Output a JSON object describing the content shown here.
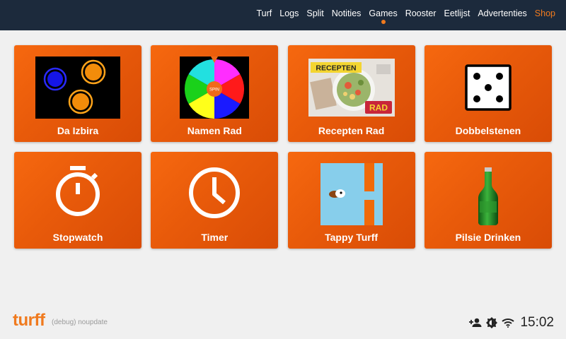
{
  "nav": {
    "items": [
      {
        "label": "Turf"
      },
      {
        "label": "Logs"
      },
      {
        "label": "Split"
      },
      {
        "label": "Notities"
      },
      {
        "label": "Games"
      },
      {
        "label": "Rooster"
      },
      {
        "label": "Eetlijst"
      },
      {
        "label": "Advertenties"
      },
      {
        "label": "Shop"
      }
    ],
    "active": "Games"
  },
  "tiles": [
    {
      "label": "Da Izbira"
    },
    {
      "label": "Namen Rad",
      "spin_text": "SPIN"
    },
    {
      "label": "Recepten Rad",
      "banner_top": "RECEPTEN",
      "banner_bottom": "RAD"
    },
    {
      "label": "Dobbelstenen"
    },
    {
      "label": "Stopwatch"
    },
    {
      "label": "Timer"
    },
    {
      "label": "Tappy Turff"
    },
    {
      "label": "Pilsie Drinken"
    }
  ],
  "footer": {
    "logo": "turff",
    "debug": "(debug) noupdate"
  },
  "status": {
    "time": "15:02",
    "icons": [
      "person-add-icon",
      "brightness-icon",
      "wifi-icon"
    ]
  },
  "colors": {
    "topbar": "#1c2a3c",
    "accent": "#f07a1e",
    "tile": "#ea5d0a"
  }
}
